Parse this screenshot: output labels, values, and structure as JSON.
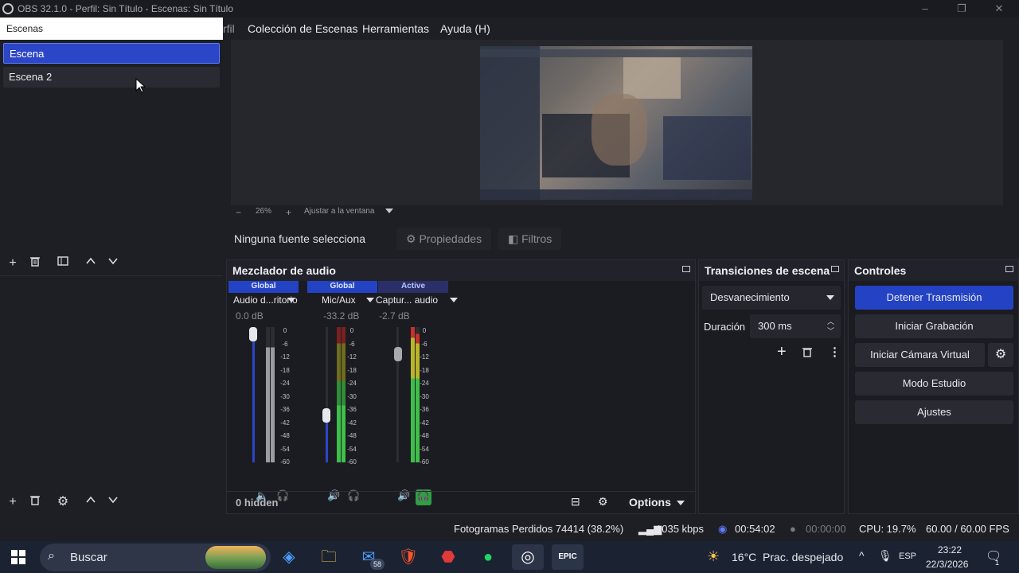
{
  "window": {
    "title": "OBS 32.1.0 - Perfil: Sin Título - Escenas: Sin Título"
  },
  "menu": {
    "cut_item": "rfil",
    "items": [
      "Colección de Escenas",
      "Herramientas",
      "Ayuda (H)"
    ]
  },
  "scenes_popup": {
    "label": "Escenas"
  },
  "scenes": {
    "items": [
      {
        "label": "Escena",
        "selected": true
      },
      {
        "label": "Escena 2",
        "selected": false
      }
    ]
  },
  "preview": {
    "zoom": "26%",
    "zoom_mode": "Ajustar a la ventana"
  },
  "sources_bar": {
    "status": "Ninguna fuente selecciona",
    "properties_label": "Propiedades",
    "filters_label": "Filtros"
  },
  "mixer": {
    "title": "Mezclador de audio",
    "channels": [
      {
        "tag": "Global",
        "name": "Audio d...ritorio",
        "db": "0.0 dB",
        "fader_level": 0.95,
        "muted": true
      },
      {
        "tag": "Global",
        "name": "Mic/Aux",
        "db": "-33.2 dB",
        "fader_level": 0.35,
        "muted": false
      },
      {
        "tag": "Active",
        "name": "Captur... audio",
        "db": "-2.7 dB",
        "fader_level": 0.8,
        "muted": false,
        "monitoring": true
      }
    ],
    "scale": [
      "0",
      "-6",
      "-12",
      "-18",
      "-24",
      "-30",
      "-36",
      "-42",
      "-48",
      "-54",
      "-60"
    ],
    "hidden_label": "0 hidden",
    "options_label": "Options"
  },
  "transitions": {
    "title": "Transiciones de escena",
    "selected": "Desvanecimiento",
    "duration_label": "Duración",
    "duration_value": "300 ms"
  },
  "controls": {
    "title": "Controles",
    "stop_stream": "Detener Transmisión",
    "start_record": "Iniciar Grabación",
    "start_vcam": "Iniciar Cámara Virtual",
    "studio_mode": "Modo Estudio",
    "settings": "Ajustes"
  },
  "status": {
    "dropped_frames": "Fotogramas Perdidos 74414 (38.2%)",
    "bitrate": "1035 kbps",
    "stream_time": "00:54:02",
    "record_time": "00:00:00",
    "cpu": "CPU: 19.7%",
    "fps": "60.00 / 60.00 FPS"
  },
  "taskbar": {
    "search_placeholder": "Buscar",
    "mail_badge": "58",
    "weather": "16°C  Prac. despejado",
    "lang": "ESP",
    "time": "23:22",
    "date": "22/3/2026",
    "notif_count": "1"
  },
  "colors": {
    "accent": "#2443c4",
    "bg": "#1e1f25",
    "meter_green": "#3fbe4a",
    "meter_yellow": "#b8b52a",
    "meter_red": "#c8302c"
  }
}
